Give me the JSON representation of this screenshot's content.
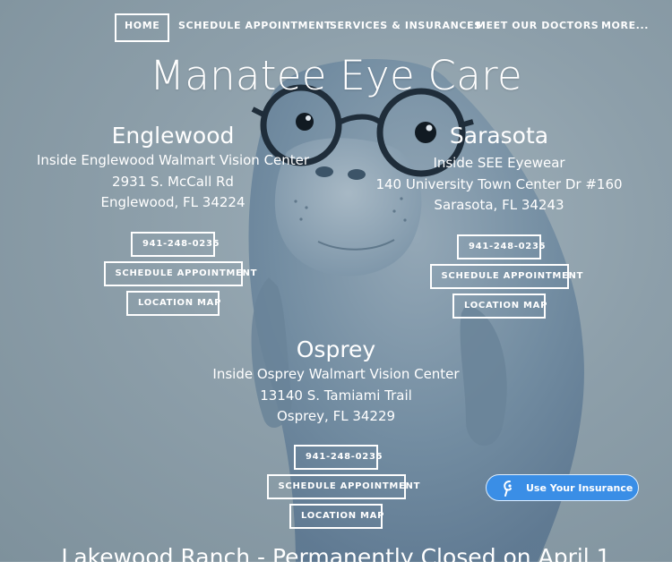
{
  "nav": {
    "items": [
      {
        "label": "HOME"
      },
      {
        "label": "SCHEDULE APPOINTMENT"
      },
      {
        "label": "SERVICES & INSURANCES"
      },
      {
        "label": "MEET OUR DOCTORS"
      },
      {
        "label": "MORE..."
      }
    ]
  },
  "site_title": "Manatee Eye Care",
  "locations": [
    {
      "name": "Englewood",
      "line1": "Inside Englewood Walmart Vision Center",
      "line2": "2931 S. McCall Rd",
      "line3": "Englewood, FL 34224",
      "phone": "941-248-0235",
      "schedule": "SCHEDULE APPOINTMENT",
      "map": "LOCATION MAP"
    },
    {
      "name": "Sarasota",
      "line1": "Inside SEE Eyewear",
      "line2": "140 University Town Center Dr #160",
      "line3": "Sarasota, FL 34243",
      "phone": "941-248-0235",
      "schedule": "SCHEDULE APPOINTMENT",
      "map": "LOCATION MAP"
    },
    {
      "name": "Osprey",
      "line1": "Inside Osprey Walmart Vision Center",
      "line2": "13140 S. Tamiami Trail",
      "line3": "Osprey, FL 34229",
      "phone": "941-248-0235",
      "schedule": "SCHEDULE APPOINTMENT",
      "map": "LOCATION MAP"
    }
  ],
  "bottom_heading": "Lakewood Ranch - Permanently Closed on April 1",
  "insurance_widget": {
    "label": "Use Your Insurance",
    "icon": "insurance-logo-icon",
    "color": "#3a8ee6"
  }
}
